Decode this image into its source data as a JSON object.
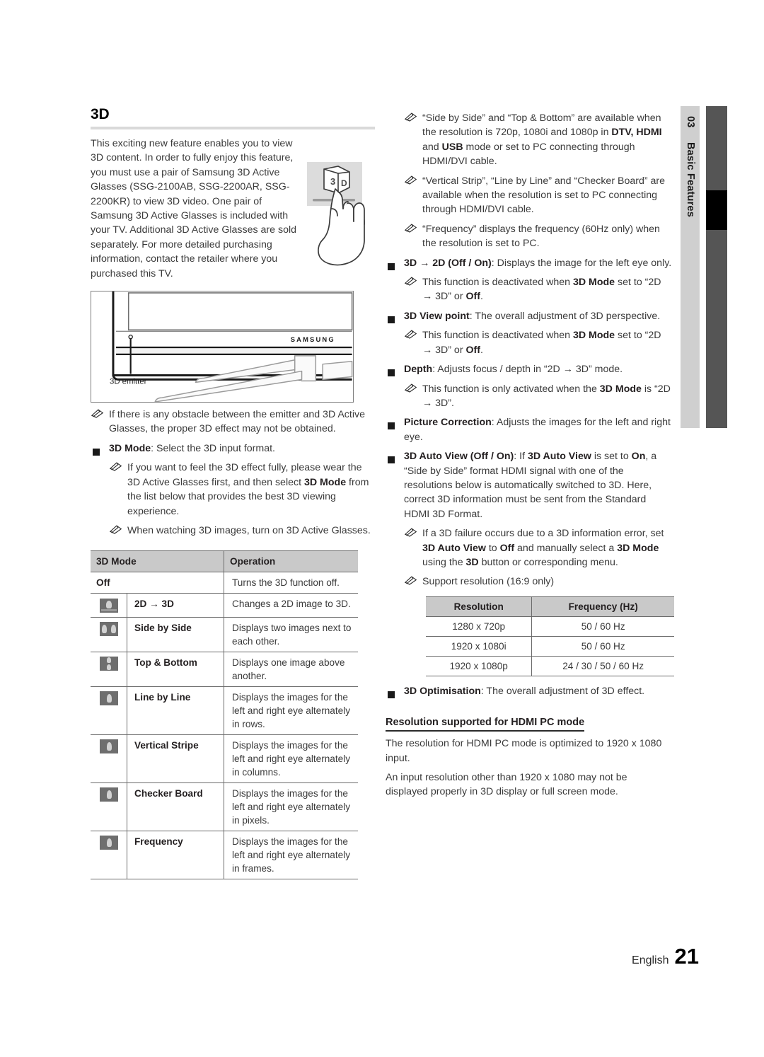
{
  "page": {
    "section_title": "3D",
    "footer_language": "English",
    "footer_page_number": "21",
    "side_tab_number": "03",
    "side_tab_label": "Basic Features"
  },
  "left_column": {
    "intro_paragraph": "This exciting new feature enables you to view 3D content. In order to fully enjoy this feature, you must use a pair of Samsung 3D Active Glasses (SSG-2100AB, SSG-2200AR, SSG-2200KR) to view 3D video. One pair of Samsung 3D Active Glasses is included with your TV. Additional 3D Active Glasses are sold separately. For more detailed purchasing information, contact the retailer where you purchased this TV.",
    "tv_figure": {
      "brand_label": "SAMSUNG",
      "callout_label": "3D emitter"
    },
    "notes": [
      {
        "type": "note",
        "level": 1,
        "text": "If there is any obstacle between the emitter and 3D Active Glasses, the proper 3D effect may not be obtained."
      },
      {
        "type": "bullet",
        "level": 1,
        "bold_lead": "3D Mode",
        "text": ": Select the 3D input format."
      },
      {
        "type": "note",
        "level": 2,
        "text_parts": [
          {
            "t": "If you want to feel the 3D effect fully, please wear the 3D Active Glasses first, and then select ",
            "b": false
          },
          {
            "t": "3D Mode",
            "b": true
          },
          {
            "t": " from the list below that provides the best 3D viewing experience.",
            "b": false
          }
        ]
      },
      {
        "type": "note",
        "level": 2,
        "text": "When watching 3D images, turn on 3D Active Glasses."
      }
    ]
  },
  "mode_table": {
    "headers": [
      "3D Mode",
      "Operation"
    ],
    "rows": [
      {
        "icon": "none",
        "name": "Off",
        "operation": "Turns the 3D function off."
      },
      {
        "icon": "2d-to-3d-icon",
        "name": "2D → 3D",
        "operation": "Changes a 2D image to 3D."
      },
      {
        "icon": "side-by-side-icon",
        "name": "Side by Side",
        "operation": "Displays two images next to each other."
      },
      {
        "icon": "top-bottom-icon",
        "name": "Top & Bottom",
        "operation": "Displays one image above another."
      },
      {
        "icon": "line-by-line-icon",
        "name": "Line by Line",
        "operation": "Displays the images for the left and right eye alternately in rows."
      },
      {
        "icon": "vertical-stripe-icon",
        "name": "Vertical Stripe",
        "operation": "Displays the images for the left and right eye alternately in columns."
      },
      {
        "icon": "checker-board-icon",
        "name": "Checker Board",
        "operation": "Displays the images for the left and right eye alternately in pixels."
      },
      {
        "icon": "frequency-icon",
        "name": "Frequency",
        "operation": "Displays the images for the left and right eye alternately in frames."
      }
    ]
  },
  "right_column": {
    "notes": [
      {
        "type": "note",
        "level": 2,
        "parts": [
          {
            "t": "“Side by Side” and “Top & Bottom” are available when the resolution is 720p, 1080i and 1080p in ",
            "b": false
          },
          {
            "t": "DTV, HDMI",
            "b": true
          },
          {
            "t": " and ",
            "b": false
          },
          {
            "t": "USB",
            "b": true
          },
          {
            "t": " mode or set to PC connecting through HDMI/DVI cable.",
            "b": false
          }
        ]
      },
      {
        "type": "note",
        "level": 2,
        "parts": [
          {
            "t": "“Vertical Strip”, “Line by Line” and “Checker Board” are available when the resolution is set to PC connecting through HDMI/DVI cable.",
            "b": false
          }
        ]
      },
      {
        "type": "note",
        "level": 2,
        "parts": [
          {
            "t": "“Frequency” displays the frequency (60Hz only) when the resolution is set to PC.",
            "b": false
          }
        ]
      },
      {
        "type": "bullet",
        "level": 1,
        "parts": [
          {
            "t": "3D → 2D (Off / On)",
            "b": true
          },
          {
            "t": ": Displays the image for the left eye only.",
            "b": false
          }
        ]
      },
      {
        "type": "note",
        "level": 2,
        "parts": [
          {
            "t": "This function is deactivated when ",
            "b": false
          },
          {
            "t": "3D Mode",
            "b": true
          },
          {
            "t": " set to “2D → 3D” or ",
            "b": false
          },
          {
            "t": "Off",
            "b": true
          },
          {
            "t": ".",
            "b": false
          }
        ]
      },
      {
        "type": "bullet",
        "level": 1,
        "parts": [
          {
            "t": "3D View point",
            "b": true
          },
          {
            "t": ": The overall adjustment of 3D perspective.",
            "b": false
          }
        ]
      },
      {
        "type": "note",
        "level": 2,
        "parts": [
          {
            "t": "This function is deactivated when ",
            "b": false
          },
          {
            "t": "3D Mode",
            "b": true
          },
          {
            "t": " set to “2D → 3D” or ",
            "b": false
          },
          {
            "t": "Off",
            "b": true
          },
          {
            "t": ".",
            "b": false
          }
        ]
      },
      {
        "type": "bullet",
        "level": 1,
        "parts": [
          {
            "t": "Depth",
            "b": true
          },
          {
            "t": ": Adjusts focus / depth in “2D → 3D” mode.",
            "b": false
          }
        ]
      },
      {
        "type": "note",
        "level": 2,
        "parts": [
          {
            "t": "This function is only activated when the ",
            "b": false
          },
          {
            "t": "3D Mode",
            "b": true
          },
          {
            "t": " is “2D → 3D”.",
            "b": false
          }
        ]
      },
      {
        "type": "bullet",
        "level": 1,
        "parts": [
          {
            "t": "Picture Correction",
            "b": true
          },
          {
            "t": ": Adjusts the images for the left and right eye.",
            "b": false
          }
        ]
      },
      {
        "type": "bullet",
        "level": 1,
        "parts": [
          {
            "t": "3D Auto View (Off / On)",
            "b": true
          },
          {
            "t": ": If ",
            "b": false
          },
          {
            "t": "3D Auto View",
            "b": true
          },
          {
            "t": " is set to ",
            "b": false
          },
          {
            "t": "On",
            "b": true
          },
          {
            "t": ", a “Side by Side” format HDMI signal with one of the resolutions below is automatically switched to 3D. Here, correct 3D information must be sent from the Standard HDMI 3D Format.",
            "b": false
          }
        ]
      },
      {
        "type": "note",
        "level": 2,
        "parts": [
          {
            "t": "If a 3D failure occurs due to a 3D information error, set ",
            "b": false
          },
          {
            "t": "3D Auto View",
            "b": true
          },
          {
            "t": " to ",
            "b": false
          },
          {
            "t": "Off",
            "b": true
          },
          {
            "t": " and manually select a ",
            "b": false
          },
          {
            "t": "3D Mode",
            "b": true
          },
          {
            "t": " using the ",
            "b": false
          },
          {
            "t": "3D",
            "b": true
          },
          {
            "t": " button or corresponding menu.",
            "b": false
          }
        ]
      },
      {
        "type": "note",
        "level": 2,
        "parts": [
          {
            "t": "Support resolution (16:9 only)",
            "b": false
          }
        ]
      }
    ],
    "resolution_table": {
      "headers": [
        "Resolution",
        "Frequency (Hz)"
      ],
      "rows": [
        [
          "1280 x 720p",
          "50 / 60 Hz"
        ],
        [
          "1920 x 1080i",
          "50 / 60 Hz"
        ],
        [
          "1920 x 1080p",
          "24 / 30 / 50 / 60 Hz"
        ]
      ]
    },
    "optimisation_bullet": {
      "parts": [
        {
          "t": "3D Optimisation",
          "b": true
        },
        {
          "t": ": The overall adjustment of 3D effect.",
          "b": false
        }
      ]
    },
    "hdmi_pc_heading": "Resolution supported for HDMI PC mode",
    "hdmi_pc_paragraphs": [
      "The resolution for HDMI PC mode is optimized to 1920 x 1080 input.",
      "An input resolution other than 1920 x 1080 may not be displayed properly in 3D display or full screen mode."
    ]
  },
  "colors": {
    "table_header_bg": "#c9c9c9",
    "heading_rule": "#d9d9d9",
    "side_tab_bg": "#cfcfcf",
    "side_bar_bg": "#555555",
    "side_bar_mark": "#000000",
    "body_text": "#3a3a3a"
  }
}
